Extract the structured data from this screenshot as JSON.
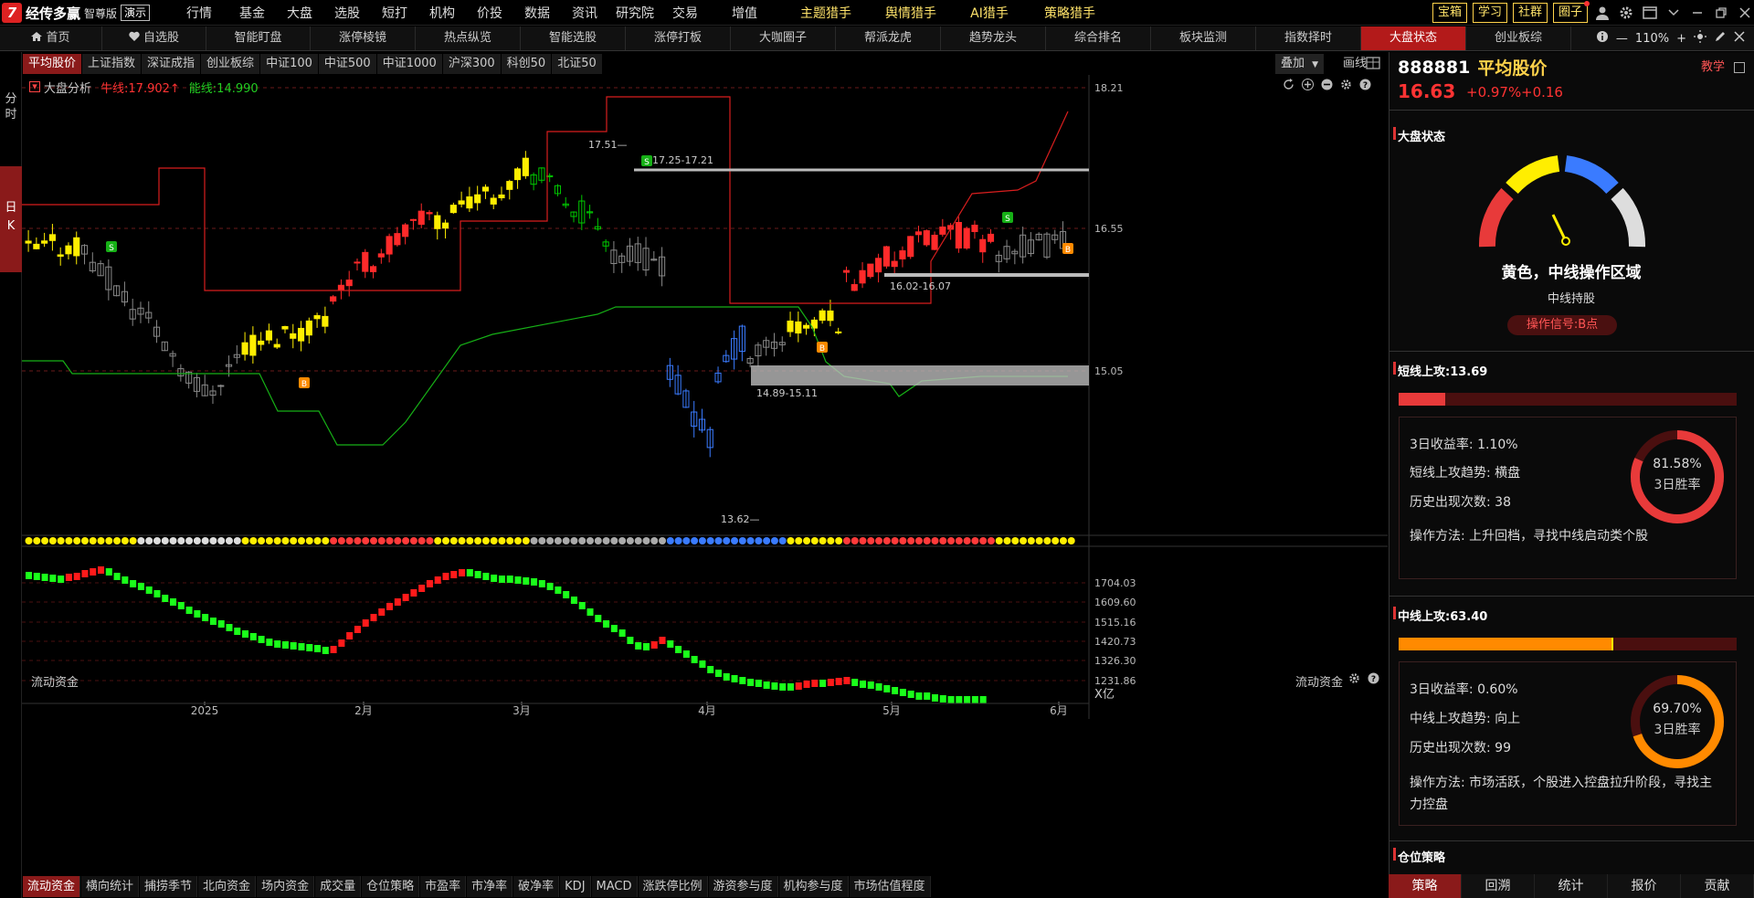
{
  "app": {
    "logo_mark": "7",
    "name": "经传多赢",
    "edition": "智尊版",
    "demo": "演示"
  },
  "main_menu": [
    {
      "label": "行情",
      "style": "n"
    },
    {
      "label": "基金",
      "style": "n"
    },
    {
      "label": "大盘",
      "style": "n"
    },
    {
      "label": "选股",
      "style": "n"
    },
    {
      "label": "短打",
      "style": "n"
    },
    {
      "label": "机构",
      "style": "n"
    },
    {
      "label": "价投",
      "style": "n"
    },
    {
      "label": "数据",
      "style": "n",
      "dot": true
    },
    {
      "label": "资讯",
      "style": "n"
    },
    {
      "label": "研究院",
      "style": "n"
    },
    {
      "label": "交易",
      "style": "n"
    },
    {
      "label": "增值",
      "style": "n"
    },
    {
      "label": "主题猎手",
      "style": "y"
    },
    {
      "label": "舆情猎手",
      "style": "y"
    },
    {
      "label": "AI猎手",
      "style": "y"
    },
    {
      "label": "策略猎手",
      "style": "y"
    }
  ],
  "top_tools": [
    "宝箱",
    "学习",
    "社群",
    "圈子"
  ],
  "nav_tabs": [
    "首页",
    "自选股",
    "智能盯盘",
    "涨停棱镜",
    "热点纵览",
    "智能选股",
    "涨停打板",
    "大咖圈子",
    "帮派龙虎",
    "趋势龙头",
    "综合排名",
    "板块监测",
    "指数择时",
    "大盘状态",
    "创业板综"
  ],
  "nav_active": 13,
  "zoom": "110%",
  "left_strip": {
    "intraday": "分\n时",
    "daily": "日\nK"
  },
  "index_tabs": [
    "平均股价",
    "上证指数",
    "深证成指",
    "创业板综",
    "中证100",
    "中证500",
    "中证1000",
    "沪深300",
    "科创50",
    "北证50"
  ],
  "index_active": 0,
  "overlay_label": "叠加",
  "drawline_label": "画线",
  "chart_legend": {
    "name": "大盘分析",
    "bull_label": "牛线:17.902",
    "bull_arrow": "↑",
    "bear_label": "能线:14.990"
  },
  "colors": {
    "up": "#ff2a2a",
    "down": "#00c800",
    "yellow": "#ffee00",
    "blue": "#3a7bff",
    "red_line": "#d81e1e",
    "green_line": "#16b016"
  },
  "chart_data": {
    "type": "candlestick",
    "title": "大盘分析",
    "y_ticks": [
      "18.21",
      "16.55",
      "15.05"
    ],
    "x_ticks": [
      "2025",
      "2月",
      "3月",
      "4月",
      "5月",
      "6月"
    ],
    "annotations": [
      "17.51",
      "17.25-17.21",
      "16.02-16.07",
      "14.89-15.11",
      "13.62"
    ],
    "flow_indicator": {
      "name": "流动资金",
      "y_ticks": [
        "1704.03",
        "1609.60",
        "1515.16",
        "1420.73",
        "1326.30",
        "1231.86"
      ],
      "unit": "X亿"
    }
  },
  "bottom_tabs": [
    "流动资金",
    "横向统计",
    "捕捞季节",
    "北向资金",
    "场内资金",
    "成交量",
    "仓位策略",
    "市盈率",
    "市净率",
    "破净率",
    "KDJ",
    "MACD",
    "涨跌停比例",
    "游资参与度",
    "机构参与度",
    "市场估值程度"
  ],
  "bottom_active": 0,
  "right": {
    "code": "888881",
    "name": "平均股价",
    "teach": "教学",
    "price": "16.63",
    "pct": "+0.97%",
    "change": "+0.16",
    "market_state_title": "大盘状态",
    "gauge_text": "黄色，中线操作区域",
    "gauge_sub": "中线持股",
    "signal": "操作信号:B点",
    "short": {
      "title": "短线上攻:13.69",
      "level": 0.137,
      "ret": "3日收益率: 1.10%",
      "trend": "短线上攻趋势: 横盘",
      "count": "历史出现次数: 38",
      "method": "操作方法: 上升回档，寻找中线启动类个股",
      "winrate": "81.58%",
      "winrate_value": 81.58,
      "winrate_label": "3日胜率"
    },
    "mid": {
      "title": "中线上攻:63.40",
      "level": 0.634,
      "ret": "3日收益率: 0.60%",
      "trend": "中线上攻趋势: 向上",
      "count": "历史出现次数: 99",
      "method": "操作方法: 市场活跃，个股进入控盘拉升阶段，寻找主力控盘",
      "winrate": "69.70%",
      "winrate_value": 69.7,
      "winrate_label": "3日胜率"
    },
    "position_title": "仓位策略",
    "bottom_tabs": [
      "策略",
      "回溯",
      "统计",
      "报价",
      "贡献"
    ],
    "bottom_active": 0
  }
}
